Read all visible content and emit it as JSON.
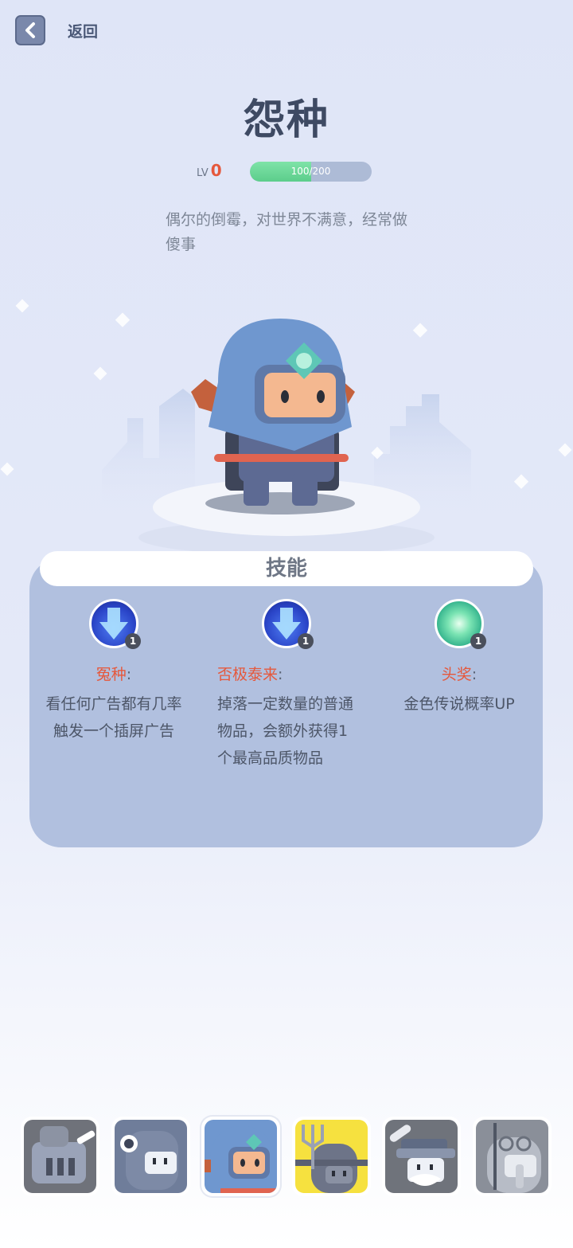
{
  "header": {
    "back_label": "返回"
  },
  "character": {
    "name": "怨种",
    "lv_label": "LV",
    "level": "0",
    "xp_text": "100/200",
    "xp_fraction": 0.5,
    "description": "偶尔的倒霉，对世界不满意，经常做傻事"
  },
  "skills": {
    "header": "技能",
    "items": [
      {
        "name": "冤种",
        "colon": ":",
        "level": "1",
        "icon": "blue-arrow-icon",
        "description": "看任何广告都有几率触发一个插屏广告"
      },
      {
        "name": "否极泰来",
        "colon": ":",
        "level": "1",
        "icon": "blue-arrow-icon",
        "description": "掉落一定数量的普通物品，会额外获得1个最高品质物品"
      },
      {
        "name": "头奖",
        "colon": ":",
        "level": "1",
        "icon": "green-energy-icon",
        "description": "金色传说概率UP"
      }
    ]
  },
  "roster": [
    {
      "name": "knight-avatar",
      "selected": false
    },
    {
      "name": "gorilla-avatar",
      "selected": false
    },
    {
      "name": "hooded-ninja-avatar",
      "selected": true
    },
    {
      "name": "trident-warrior-avatar",
      "selected": false
    },
    {
      "name": "old-wizard-avatar",
      "selected": false
    },
    {
      "name": "elephant-pilot-avatar",
      "selected": false
    }
  ],
  "colors": {
    "accent_red": "#e5583c",
    "xp_green": "#5ccd8b",
    "panel_blue": "#b1c0df",
    "hood_blue": "#6f97cf"
  }
}
